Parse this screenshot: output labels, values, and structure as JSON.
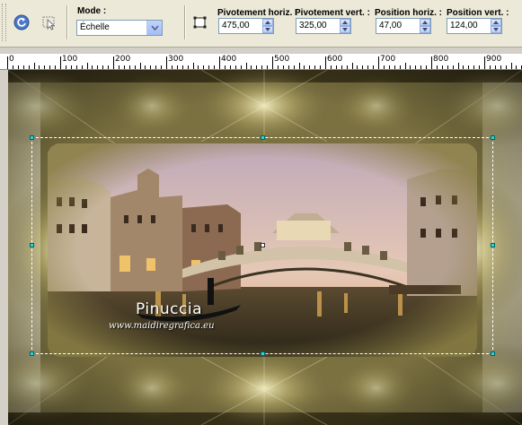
{
  "toolbar": {
    "mode_label": "Mode :",
    "mode_value": "Échelle",
    "fields": [
      {
        "label": "Pivotement horiz. :",
        "value": "475,00"
      },
      {
        "label": "Pivotement vert. :",
        "value": "325,00"
      },
      {
        "label": "Position horiz. :",
        "value": "47,00"
      },
      {
        "label": "Position vert. :",
        "value": "124,00"
      }
    ]
  },
  "ruler": {
    "labels": [
      "0",
      "100",
      "200",
      "300",
      "400",
      "500",
      "600",
      "700",
      "800",
      "900"
    ]
  },
  "canvas": {
    "watermark_title": "Pinuccia",
    "watermark_url": "www.maidiregrafica.eu"
  },
  "colors": {
    "toolbar_bg": "#ece9d8",
    "handle": "#2fd3d3",
    "canvas_dominant": "#8a7f45"
  },
  "icons": [
    "reset-icon",
    "pick-tool-icon",
    "frame-icon",
    "chevron-down-icon",
    "spin-up-icon",
    "spin-down-icon"
  ]
}
